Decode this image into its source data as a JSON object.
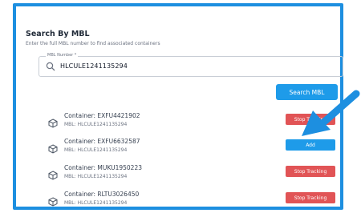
{
  "panel": {
    "title": "Search By MBL",
    "subtitle": "Enter the full MBL number to find associated containers"
  },
  "search": {
    "label": "MBL Number *",
    "value": "HLCULE1241135294",
    "button_label": "Search MBL"
  },
  "containers": [
    {
      "name": "Container: EXFU4421902",
      "mbl": "MBL: HLCULE1241135294",
      "action": "Stop Tracking",
      "action_type": "stop"
    },
    {
      "name": "Container: EXFU6632587",
      "mbl": "MBL: HLCULE1241135294",
      "action": "Add",
      "action_type": "add"
    },
    {
      "name": "Container: MUKU1950223",
      "mbl": "MBL: HLCULE1241135294",
      "action": "Stop Tracking",
      "action_type": "stop"
    },
    {
      "name": "Container: RLTU3026450",
      "mbl": "MBL: HLCULE1241135294",
      "action": "Stop Tracking",
      "action_type": "stop"
    }
  ],
  "colors": {
    "frame": "#1d8fe0",
    "primary": "#1e9be9",
    "danger": "#e15456",
    "arrow": "#1d8fe0"
  },
  "icons": {
    "search": "search-icon",
    "container": "box-icon",
    "pointer": "arrow-pointer-icon"
  }
}
